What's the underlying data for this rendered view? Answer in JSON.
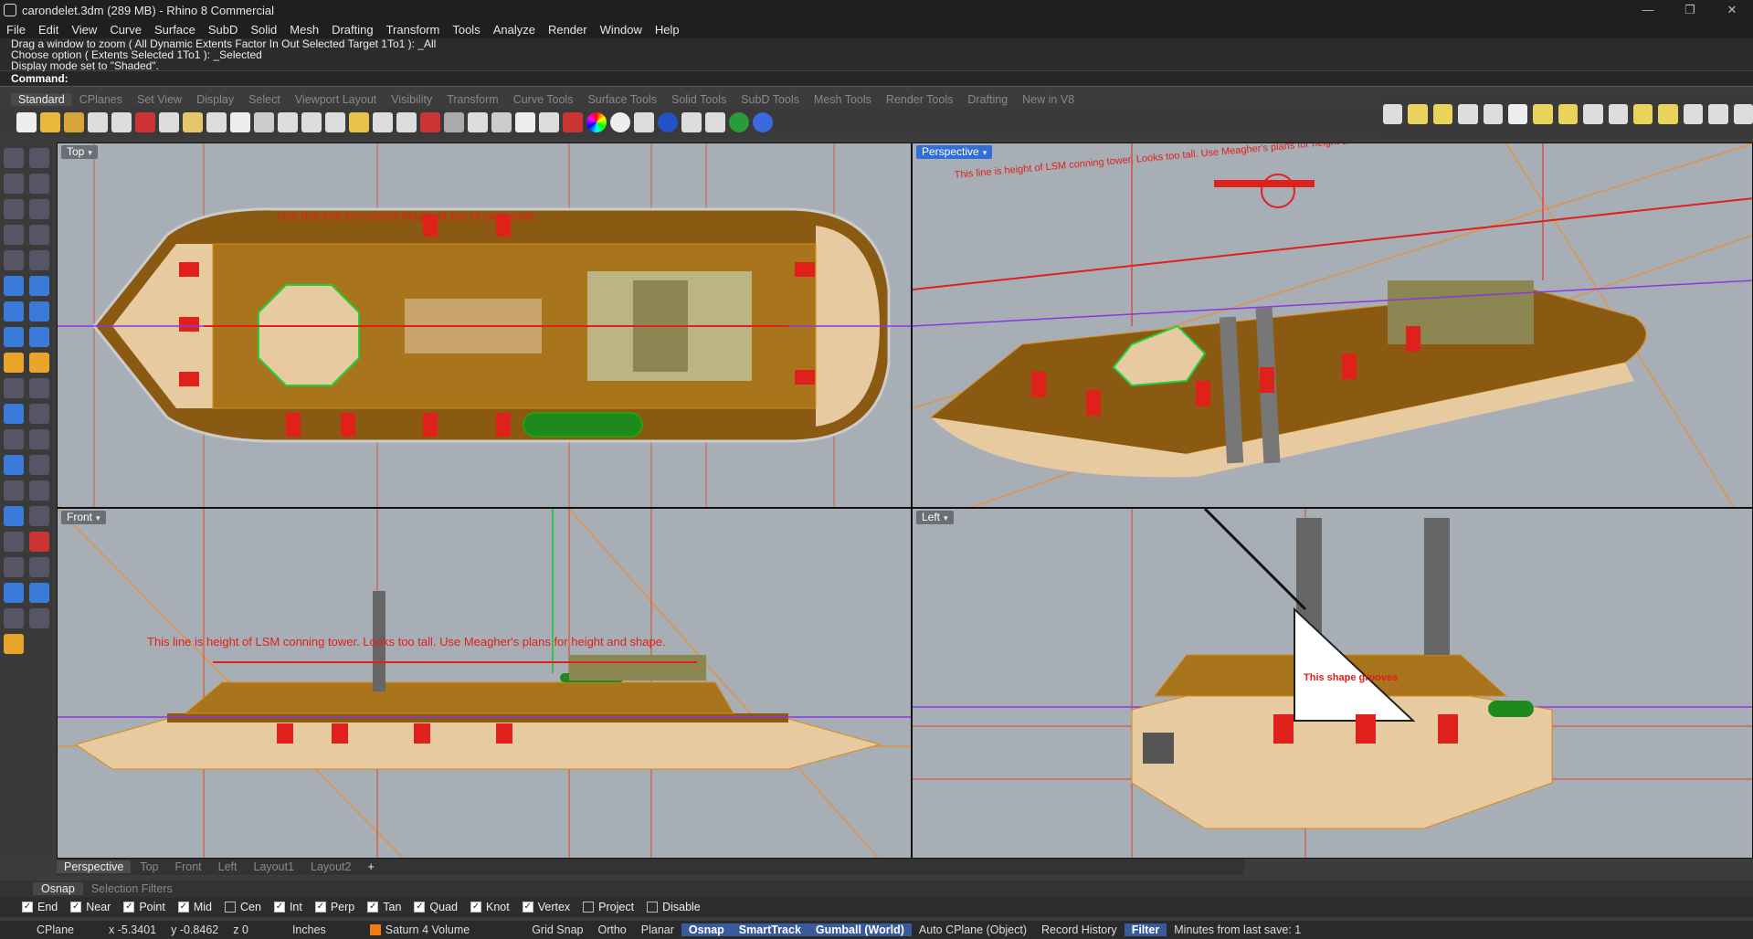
{
  "window": {
    "title": "carondelet.3dm (289 MB) - Rhino 8 Commercial"
  },
  "menu": [
    "File",
    "Edit",
    "View",
    "Curve",
    "Surface",
    "SubD",
    "Solid",
    "Mesh",
    "Drafting",
    "Transform",
    "Tools",
    "Analyze",
    "Render",
    "Window",
    "Help"
  ],
  "command": {
    "history": [
      "Drag a window to zoom ( All Dynamic Extents Factor In Out Selected Target 1To1 ): _All",
      "Choose option ( Extents Selected 1To1 ): _Selected",
      "Display mode set to \"Shaded\"."
    ],
    "prompt": "Command:"
  },
  "toolbar_tabs": [
    "Standard",
    "CPlanes",
    "Set View",
    "Display",
    "Select",
    "Viewport Layout",
    "Visibility",
    "Transform",
    "Curve Tools",
    "Surface Tools",
    "Solid Tools",
    "SubD Tools",
    "Mesh Tools",
    "Render Tools",
    "Drafting",
    "New in V8"
  ],
  "viewports": {
    "top": {
      "label": "Top",
      "note": "Use this line for correct height of top of casemate."
    },
    "perspective": {
      "label": "Perspective",
      "note": "This line is height of LSM conning tower. Looks too tall. Use Meagher's plans for height and shape."
    },
    "front": {
      "label": "Front",
      "note": "This line is height of LSM conning tower. Looks too tall. Use Meagher's plans for height and shape."
    },
    "left": {
      "label": "Left",
      "note": "This shape grooves"
    }
  },
  "view_tabs": [
    "Perspective",
    "Top",
    "Front",
    "Left",
    "Layout1",
    "Layout2"
  ],
  "panel_tabs": [
    "Osnap",
    "Selection Filters"
  ],
  "osnaps": [
    {
      "label": "End",
      "checked": true
    },
    {
      "label": "Near",
      "checked": true
    },
    {
      "label": "Point",
      "checked": true
    },
    {
      "label": "Mid",
      "checked": true
    },
    {
      "label": "Cen",
      "checked": false
    },
    {
      "label": "Int",
      "checked": true
    },
    {
      "label": "Perp",
      "checked": true
    },
    {
      "label": "Tan",
      "checked": true
    },
    {
      "label": "Quad",
      "checked": true
    },
    {
      "label": "Knot",
      "checked": true
    },
    {
      "label": "Vertex",
      "checked": true
    },
    {
      "label": "Project",
      "checked": false
    },
    {
      "label": "Disable",
      "checked": false
    }
  ],
  "status": {
    "cplane": "CPlane",
    "x": "x -5.3401",
    "y": "y -0.8462",
    "z": "z 0",
    "units": "Inches",
    "layer": "Saturn 4 Volume",
    "grid_snap": "Grid Snap",
    "ortho": "Ortho",
    "planar": "Planar",
    "osnap": "Osnap",
    "smarttrack": "SmartTrack",
    "gumball": "Gumball (World)",
    "auto_cplane": "Auto CPlane (Object)",
    "record_history": "Record History",
    "filter": "Filter",
    "last_save": "Minutes from last save: 1"
  },
  "colors": {
    "hull": "#8a5a12",
    "deck": "#a8741c",
    "wood": "#e7caa0",
    "red": "#e0201a",
    "viewport_bg": "#a7aeb6",
    "accent": "#2f6fd6"
  }
}
